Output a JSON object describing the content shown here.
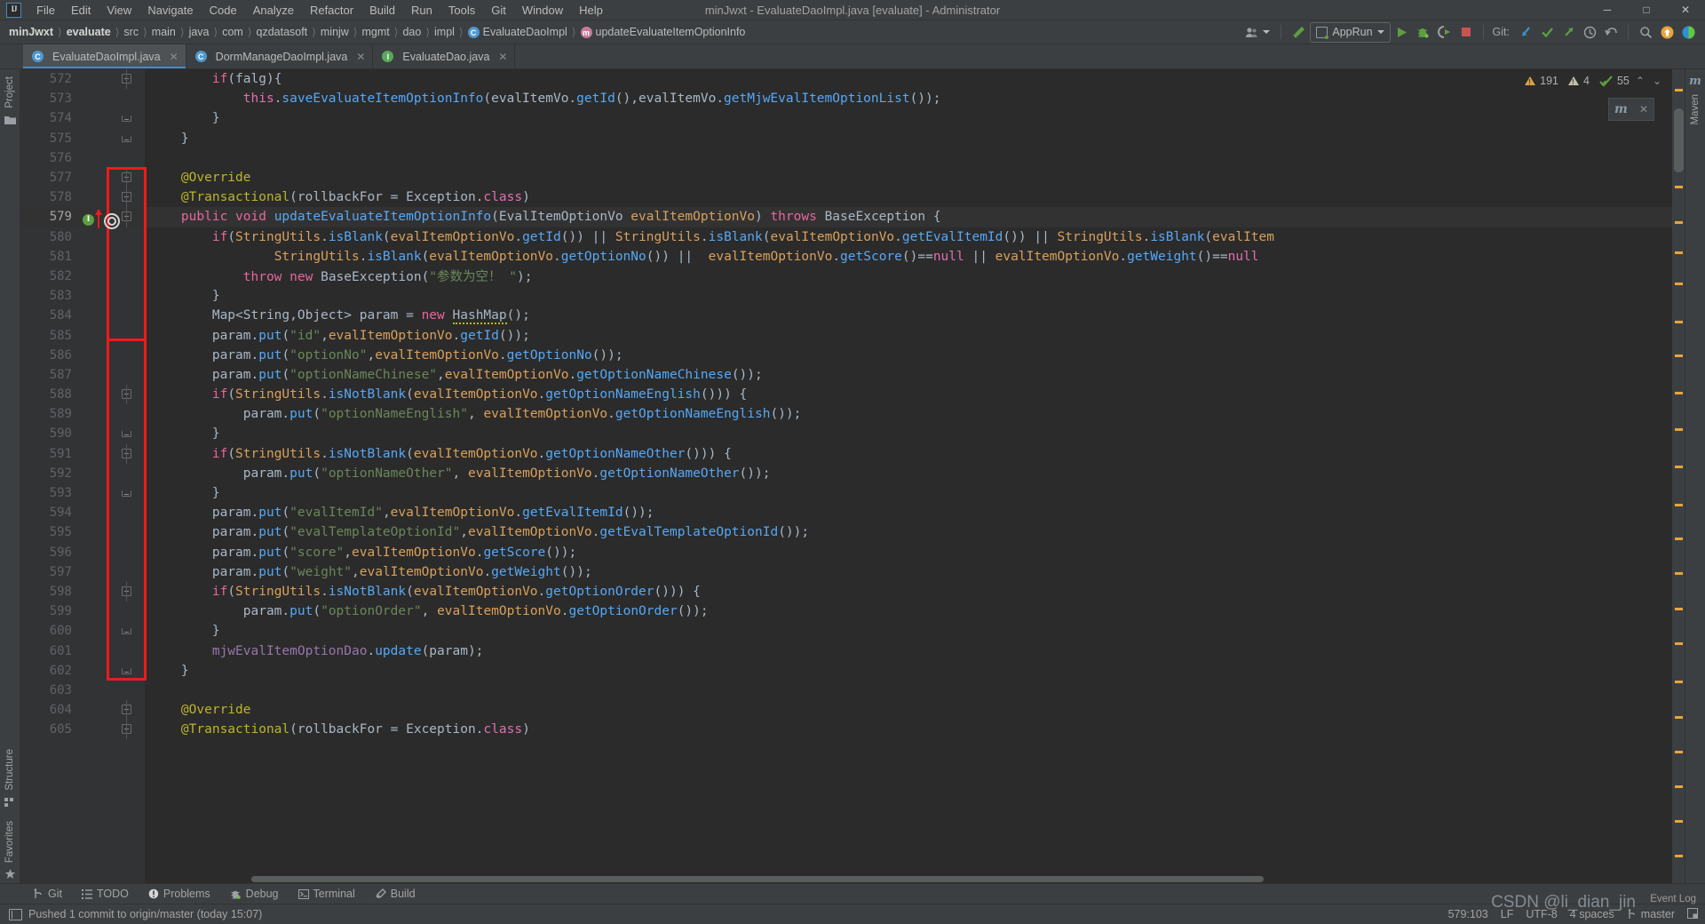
{
  "window": {
    "title": "minJwxt - EvaluateDaoImpl.java [evaluate] - Administrator",
    "logo": "IJ",
    "minimize": "─",
    "maximize": "□",
    "close": "✕"
  },
  "menu": {
    "items": [
      "File",
      "Edit",
      "View",
      "Navigate",
      "Code",
      "Analyze",
      "Refactor",
      "Build",
      "Run",
      "Tools",
      "Git",
      "Window",
      "Help"
    ]
  },
  "breadcrumbs": [
    {
      "label": "minJwxt",
      "bold": true,
      "icon": ""
    },
    {
      "label": "evaluate",
      "bold": true,
      "icon": ""
    },
    {
      "label": "src",
      "bold": false,
      "icon": ""
    },
    {
      "label": "main",
      "bold": false,
      "icon": ""
    },
    {
      "label": "java",
      "bold": false,
      "icon": ""
    },
    {
      "label": "com",
      "bold": false,
      "icon": ""
    },
    {
      "label": "qzdatasoft",
      "bold": false,
      "icon": ""
    },
    {
      "label": "minjw",
      "bold": false,
      "icon": ""
    },
    {
      "label": "mgmt",
      "bold": false,
      "icon": ""
    },
    {
      "label": "dao",
      "bold": false,
      "icon": ""
    },
    {
      "label": "impl",
      "bold": false,
      "icon": ""
    },
    {
      "label": "EvaluateDaoImpl",
      "bold": false,
      "icon": "class-icon"
    },
    {
      "label": "updateEvaluateItemOptionInfo",
      "bold": false,
      "icon": "method-icon"
    }
  ],
  "toolbar": {
    "run_config_label": "AppRun",
    "git_label": "Git:",
    "icons": [
      "user-avatar-icon",
      "hammer-build-icon",
      "run-icon",
      "debug-icon",
      "run-coverage-icon",
      "stop-icon",
      "git-update-icon",
      "git-commit-icon",
      "git-push-icon",
      "history-icon",
      "rollback-icon",
      "search-icon",
      "update-badge-icon",
      "ide-feature-icon"
    ]
  },
  "tabs": [
    {
      "label": "EvaluateDaoImpl.java",
      "icon": "class-icon",
      "active": true,
      "close": "✕"
    },
    {
      "label": "DormManageDaoImpl.java",
      "icon": "class-icon",
      "active": false,
      "close": "✕"
    },
    {
      "label": "EvaluateDao.java",
      "icon": "interface-icon",
      "active": false,
      "close": "✕"
    }
  ],
  "left_strip": {
    "top": [
      "Project"
    ],
    "bottom": [
      "Structure",
      "Favorites"
    ]
  },
  "right_strip": {
    "labels": [
      "Maven"
    ]
  },
  "inspection": {
    "warnings_count": "191",
    "weak_warnings_count": "4",
    "typos_count": "55",
    "up_chevron": "⌃",
    "down_chevron": "⌄"
  },
  "maven_popup": {
    "glyph": "m",
    "close": "✕"
  },
  "editor": {
    "first_line": 572,
    "caret_line": 579,
    "code_lines": [
      {
        "n": 572,
        "fold": "mid",
        "html": "        <span class='kw2'>if</span><span class='ident'>(falg){</span>"
      },
      {
        "n": 573,
        "fold": "none",
        "html": "            <span class='mag'>this</span><span class='ident'>.</span><span class='blu'>saveEvaluateItemOptionInfo</span><span class='ident'>(evalItemVo.</span><span class='blu'>getId</span><span class='ident'>(),evalItemVo.</span><span class='blu'>getMjwEvalItemOptionList</span><span class='ident'>());</span>"
      },
      {
        "n": 574,
        "fold": "end",
        "html": "        <span class='ident'>}</span>"
      },
      {
        "n": 575,
        "fold": "end",
        "html": "    <span class='ident'>}</span>"
      },
      {
        "n": 576,
        "fold": "none",
        "html": ""
      },
      {
        "n": 577,
        "fold": "mid",
        "html": "    <span class='ann'>@Override</span>"
      },
      {
        "n": 578,
        "fold": "mid",
        "html": "    <span class='ann'>@Transactional</span><span class='ident'>(</span><span class='ident'>rollbackFor</span> <span class='ident'>=</span> <span class='ident'>Exception</span><span class='ident'>.</span><span class='mag'>class</span><span class='ident'>)</span>"
      },
      {
        "n": 579,
        "fold": "mid",
        "html": "    <span class='kw2'>public</span> <span class='kw2'>void</span> <span class='blu'>updateEvaluateItemOptionInfo</span><span class='ident'>(</span><span class='ident'>EvalItemOptionVo</span> <span class='org'>evalItemOptionVo</span><span class='ident'>)</span> <span class='kw2'>throws</span> <span class='ident'>BaseException</span> <span class='ident'>{</span>"
      },
      {
        "n": 580,
        "fold": "none",
        "html": "        <span class='kw2'>if</span><span class='ident'>(</span><span class='org'>StringUtils</span><span class='ident'>.</span><span class='blu'>isBlank</span><span class='ident'>(</span><span class='org'>evalItemOptionVo</span><span class='ident'>.</span><span class='blu'>getId</span><span class='ident'>())</span> <span class='ident'>||</span> <span class='org'>StringUtils</span><span class='ident'>.</span><span class='blu'>isBlank</span><span class='ident'>(</span><span class='org'>evalItemOptionVo</span><span class='ident'>.</span><span class='blu'>getEvalItemId</span><span class='ident'>())</span> <span class='ident'>||</span> <span class='org'>StringUtils</span><span class='ident'>.</span><span class='blu'>isBlank</span><span class='ident'>(</span><span class='org'>evalItem</span>"
      },
      {
        "n": 581,
        "fold": "none",
        "html": "                <span class='org'>StringUtils</span><span class='ident'>.</span><span class='blu'>isBlank</span><span class='ident'>(</span><span class='org'>evalItemOptionVo</span><span class='ident'>.</span><span class='blu'>getOptionNo</span><span class='ident'>())</span> <span class='ident'>||</span>  <span class='org'>evalItemOptionVo</span><span class='ident'>.</span><span class='blu'>getScore</span><span class='ident'>()==</span><span class='nullv'>null</span> <span class='ident'>||</span> <span class='org'>evalItemOptionVo</span><span class='ident'>.</span><span class='blu'>getWeight</span><span class='ident'>()==</span><span class='nullv'>null</span>"
      },
      {
        "n": 582,
        "fold": "none",
        "html": "            <span class='kw2'>throw</span> <span class='kw2'>new</span> <span class='ident'>BaseException</span><span class='ident'>(</span><span class='str'>\"参数为空！ \"</span><span class='ident'>);</span>"
      },
      {
        "n": 583,
        "fold": "none",
        "html": "        <span class='ident'>}</span>"
      },
      {
        "n": 584,
        "fold": "none",
        "html": "        <span class='ident'>Map&lt;String,Object&gt; param =</span> <span class='kw2'>new</span> <span class='ident warnunder'>HashMap</span><span class='ident'>();</span>"
      },
      {
        "n": 585,
        "fold": "none",
        "html": "        <span class='ident'>param.</span><span class='blu'>put</span><span class='ident'>(</span><span class='str'>\"id\"</span><span class='ident'>,</span><span class='org'>evalItemOptionVo</span><span class='ident'>.</span><span class='blu'>getId</span><span class='ident'>());</span>"
      },
      {
        "n": 586,
        "fold": "none",
        "html": "        <span class='ident'>param.</span><span class='blu'>put</span><span class='ident'>(</span><span class='str'>\"optionNo\"</span><span class='ident'>,</span><span class='org'>evalItemOptionVo</span><span class='ident'>.</span><span class='blu'>getOptionNo</span><span class='ident'>());</span>"
      },
      {
        "n": 587,
        "fold": "none",
        "html": "        <span class='ident'>param.</span><span class='blu'>put</span><span class='ident'>(</span><span class='str'>\"optionNameChinese\"</span><span class='ident'>,</span><span class='org'>evalItemOptionVo</span><span class='ident'>.</span><span class='blu'>getOptionNameChinese</span><span class='ident'>());</span>"
      },
      {
        "n": 588,
        "fold": "mid",
        "html": "        <span class='kw2'>if</span><span class='ident'>(</span><span class='org'>StringUtils</span><span class='ident'>.</span><span class='blu'>isNotBlank</span><span class='ident'>(</span><span class='org'>evalItemOptionVo</span><span class='ident'>.</span><span class='blu'>getOptionNameEnglish</span><span class='ident'>()))</span> <span class='ident'>{</span>"
      },
      {
        "n": 589,
        "fold": "none",
        "html": "            <span class='ident'>param.</span><span class='blu'>put</span><span class='ident'>(</span><span class='str'>\"optionNameEnglish\"</span><span class='ident'>,</span> <span class='org'>evalItemOptionVo</span><span class='ident'>.</span><span class='blu'>getOptionNameEnglish</span><span class='ident'>());</span>"
      },
      {
        "n": 590,
        "fold": "end",
        "html": "        <span class='ident'>}</span>"
      },
      {
        "n": 591,
        "fold": "mid",
        "html": "        <span class='kw2'>if</span><span class='ident'>(</span><span class='org'>StringUtils</span><span class='ident'>.</span><span class='blu'>isNotBlank</span><span class='ident'>(</span><span class='org'>evalItemOptionVo</span><span class='ident'>.</span><span class='blu'>getOptionNameOther</span><span class='ident'>()))</span> <span class='ident'>{</span>"
      },
      {
        "n": 592,
        "fold": "none",
        "html": "            <span class='ident'>param.</span><span class='blu'>put</span><span class='ident'>(</span><span class='str'>\"optionNameOther\"</span><span class='ident'>,</span> <span class='org'>evalItemOptionVo</span><span class='ident'>.</span><span class='blu'>getOptionNameOther</span><span class='ident'>());</span>"
      },
      {
        "n": 593,
        "fold": "end",
        "html": "        <span class='ident'>}</span>"
      },
      {
        "n": 594,
        "fold": "none",
        "html": "        <span class='ident'>param.</span><span class='blu'>put</span><span class='ident'>(</span><span class='str'>\"evalItemId\"</span><span class='ident'>,</span><span class='org'>evalItemOptionVo</span><span class='ident'>.</span><span class='blu'>getEvalItemId</span><span class='ident'>());</span>"
      },
      {
        "n": 595,
        "fold": "none",
        "html": "        <span class='ident'>param.</span><span class='blu'>put</span><span class='ident'>(</span><span class='str'>\"evalTemplateOptionId\"</span><span class='ident'>,</span><span class='org'>evalItemOptionVo</span><span class='ident'>.</span><span class='blu'>getEvalTemplateOptionId</span><span class='ident'>());</span>"
      },
      {
        "n": 596,
        "fold": "none",
        "html": "        <span class='ident'>param.</span><span class='blu'>put</span><span class='ident'>(</span><span class='str'>\"score\"</span><span class='ident'>,</span><span class='org'>evalItemOptionVo</span><span class='ident'>.</span><span class='blu'>getScore</span><span class='ident'>());</span>"
      },
      {
        "n": 597,
        "fold": "none",
        "html": "        <span class='ident'>param.</span><span class='blu'>put</span><span class='ident'>(</span><span class='str'>\"weight\"</span><span class='ident'>,</span><span class='org'>evalItemOptionVo</span><span class='ident'>.</span><span class='blu'>getWeight</span><span class='ident'>());</span>"
      },
      {
        "n": 598,
        "fold": "mid",
        "html": "        <span class='kw2'>if</span><span class='ident'>(</span><span class='org'>StringUtils</span><span class='ident'>.</span><span class='blu'>isNotBlank</span><span class='ident'>(</span><span class='org'>evalItemOptionVo</span><span class='ident'>.</span><span class='blu'>getOptionOrder</span><span class='ident'>()))</span> <span class='ident'>{</span>"
      },
      {
        "n": 599,
        "fold": "none",
        "html": "            <span class='ident'>param.</span><span class='blu'>put</span><span class='ident'>(</span><span class='str'>\"optionOrder\"</span><span class='ident'>,</span> <span class='org'>evalItemOptionVo</span><span class='ident'>.</span><span class='blu'>getOptionOrder</span><span class='ident'>());</span>"
      },
      {
        "n": 600,
        "fold": "end",
        "html": "        <span class='ident'>}</span>"
      },
      {
        "n": 601,
        "fold": "none",
        "html": "        <span class='fld'>mjwEvalItemOptionDao</span><span class='ident'>.</span><span class='blu'>update</span><span class='ident'>(param);</span>"
      },
      {
        "n": 602,
        "fold": "end",
        "html": "    <span class='ident'>}</span>"
      },
      {
        "n": 603,
        "fold": "none",
        "html": ""
      },
      {
        "n": 604,
        "fold": "mid",
        "html": "    <span class='ann'>@Override</span>"
      },
      {
        "n": 605,
        "fold": "mid",
        "html": "    <span class='ann'>@Transactional</span><span class='ident'>(</span><span class='ident'>rollbackFor</span> <span class='ident'>=</span> <span class='ident'>Exception</span><span class='ident'>.</span><span class='mag'>class</span><span class='ident'>)</span>"
      }
    ]
  },
  "bottom_tools": [
    {
      "label": "Git",
      "icon": "git-branch-icon"
    },
    {
      "label": "TODO",
      "icon": "list-icon"
    },
    {
      "label": "Problems",
      "icon": "problems-icon"
    },
    {
      "label": "Debug",
      "icon": "bug-icon"
    },
    {
      "label": "Terminal",
      "icon": "terminal-icon"
    },
    {
      "label": "Build",
      "icon": "hammer-icon"
    }
  ],
  "status": {
    "message": "Pushed 1 commit to origin/master (today 15:07)",
    "caret_position": "579:103",
    "line_separator": "LF",
    "encoding": "UTF-8",
    "indent": "4 spaces",
    "branch": "master",
    "event_log": "Event Log",
    "watermark": "CSDN @li_dian_jin"
  },
  "colors": {
    "accent_blue": "#4a88c7",
    "panel_bg": "#3c3f41",
    "editor_bg": "#2b2b2b",
    "gutter_bg": "#313335",
    "annotation_red": "#ee1b1b",
    "warning_orange": "#d9a343",
    "string_green": "#6a8759",
    "keyword_orange": "#cc7832"
  }
}
